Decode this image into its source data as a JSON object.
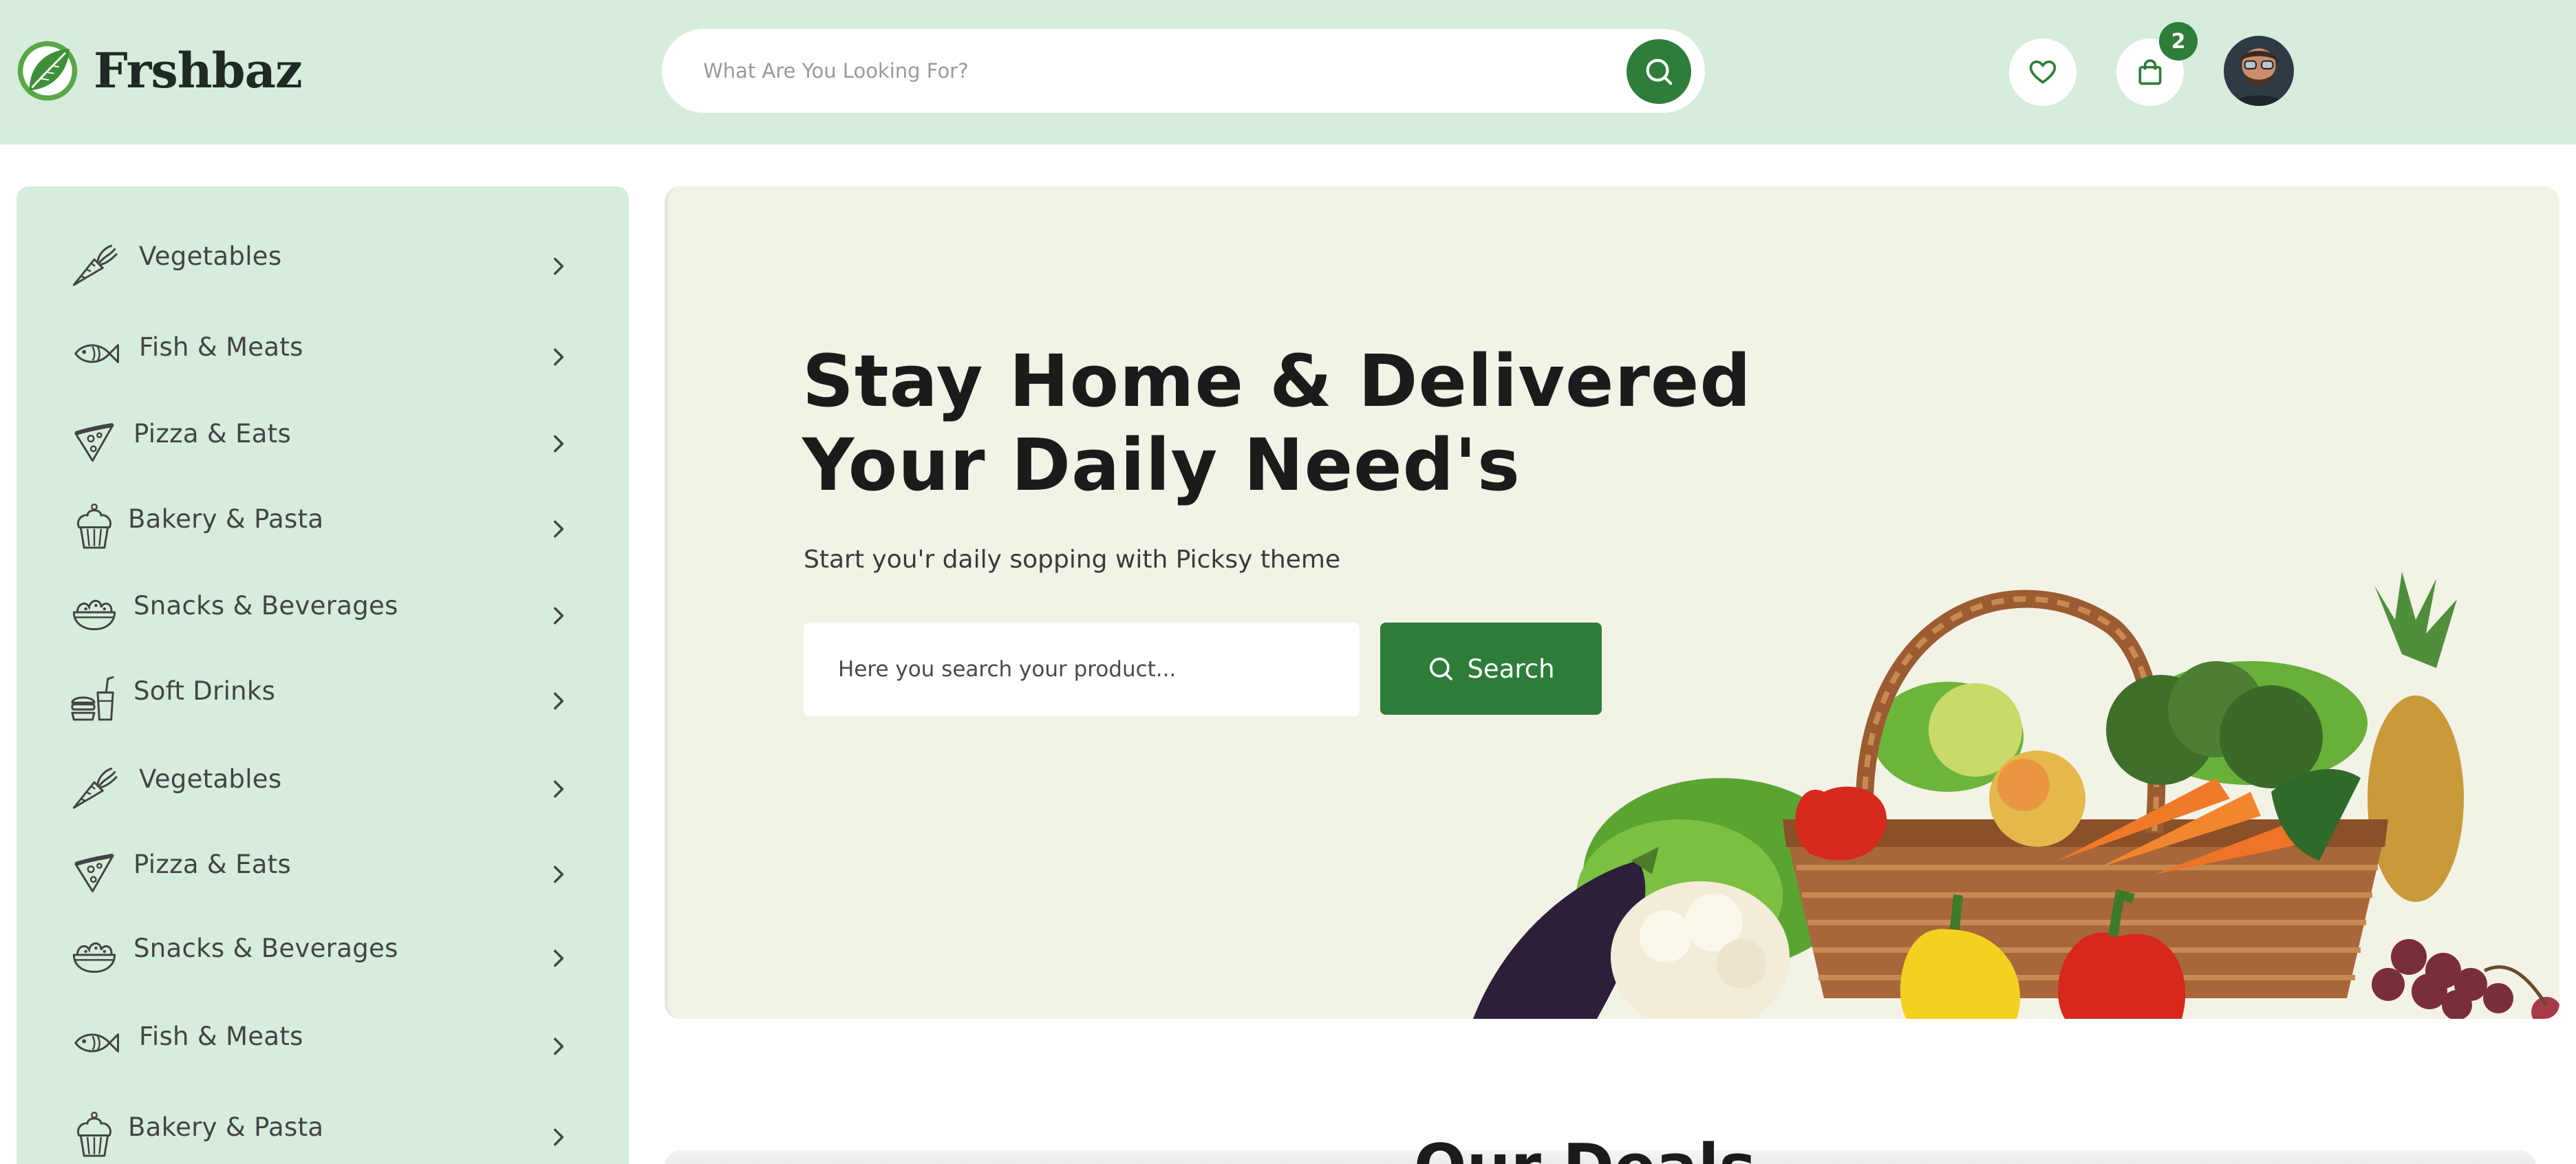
{
  "header": {
    "brand": "Frshbaz",
    "search_placeholder": "What Are You Looking For?",
    "search_icon": "search-icon",
    "wishlist_icon": "heart-icon",
    "cart_icon": "shopping-bag-icon",
    "cart_count": "2"
  },
  "sidebar": {
    "items": [
      {
        "label": "Vegetables",
        "icon": "carrot-icon"
      },
      {
        "label": "Fish & Meats",
        "icon": "fish-icon"
      },
      {
        "label": "Pizza & Eats",
        "icon": "pizza-icon"
      },
      {
        "label": "Bakery & Pasta",
        "icon": "cupcake-icon"
      },
      {
        "label": "Snacks & Beverages",
        "icon": "salad-bowl-icon"
      },
      {
        "label": "Soft Drinks",
        "icon": "drinks-icon"
      },
      {
        "label": "Vegetables",
        "icon": "carrot-icon"
      },
      {
        "label": "Pizza & Eats",
        "icon": "pizza-icon"
      },
      {
        "label": "Snacks & Beverages",
        "icon": "salad-bowl-icon"
      },
      {
        "label": "Fish & Meats",
        "icon": "fish-icon"
      },
      {
        "label": "Bakery & Pasta",
        "icon": "cupcake-icon"
      }
    ]
  },
  "hero": {
    "title_line1": "Stay Home & Delivered",
    "title_line2": "Your Daily Need's",
    "subtitle": "Start you'r daily sopping with Picksy theme",
    "search_placeholder": "Here you search your product...",
    "search_button": "Search"
  },
  "next_section": {
    "heading_partial": "Our Deals"
  },
  "colors": {
    "brand_green": "#2e7d3a",
    "header_bg": "#d6eddc",
    "hero_bg": "#f3f2e7"
  }
}
